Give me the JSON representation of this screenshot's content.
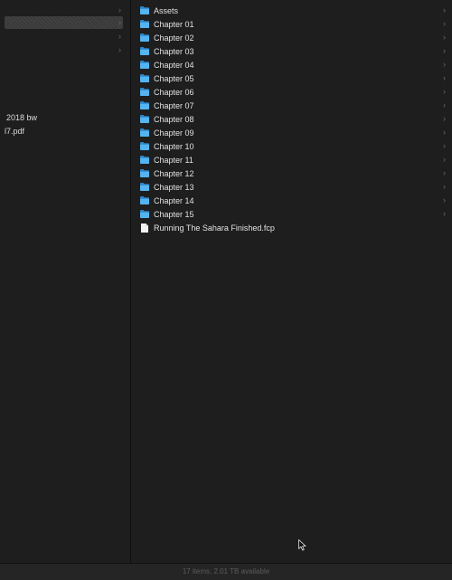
{
  "left_column": {
    "partial_labels": [
      "2018 bw",
      "l7.pdf"
    ]
  },
  "files": [
    {
      "name": "Assets",
      "type": "folder"
    },
    {
      "name": "Chapter 01",
      "type": "folder"
    },
    {
      "name": "Chapter 02",
      "type": "folder"
    },
    {
      "name": "Chapter 03",
      "type": "folder"
    },
    {
      "name": "Chapter 04",
      "type": "folder"
    },
    {
      "name": "Chapter 05",
      "type": "folder"
    },
    {
      "name": "Chapter 06",
      "type": "folder"
    },
    {
      "name": "Chapter 07",
      "type": "folder"
    },
    {
      "name": "Chapter 08",
      "type": "folder"
    },
    {
      "name": "Chapter 09",
      "type": "folder"
    },
    {
      "name": "Chapter 10",
      "type": "folder"
    },
    {
      "name": "Chapter 11",
      "type": "folder"
    },
    {
      "name": "Chapter 12",
      "type": "folder"
    },
    {
      "name": "Chapter 13",
      "type": "folder"
    },
    {
      "name": "Chapter 14",
      "type": "folder"
    },
    {
      "name": "Chapter 15",
      "type": "folder"
    },
    {
      "name": "Running The Sahara Finished.fcp",
      "type": "document"
    }
  ],
  "status_bar": {
    "text": "17 items, 2.01 TB available"
  },
  "icons": {
    "folder": "folder-icon",
    "document": "document-icon",
    "chevron": "chevron-right-icon",
    "cursor": "mouse-pointer-icon"
  },
  "colors": {
    "background": "#1e1e1e",
    "folder_blue": "#4aa8e8",
    "selection": "#3a3a3a"
  }
}
